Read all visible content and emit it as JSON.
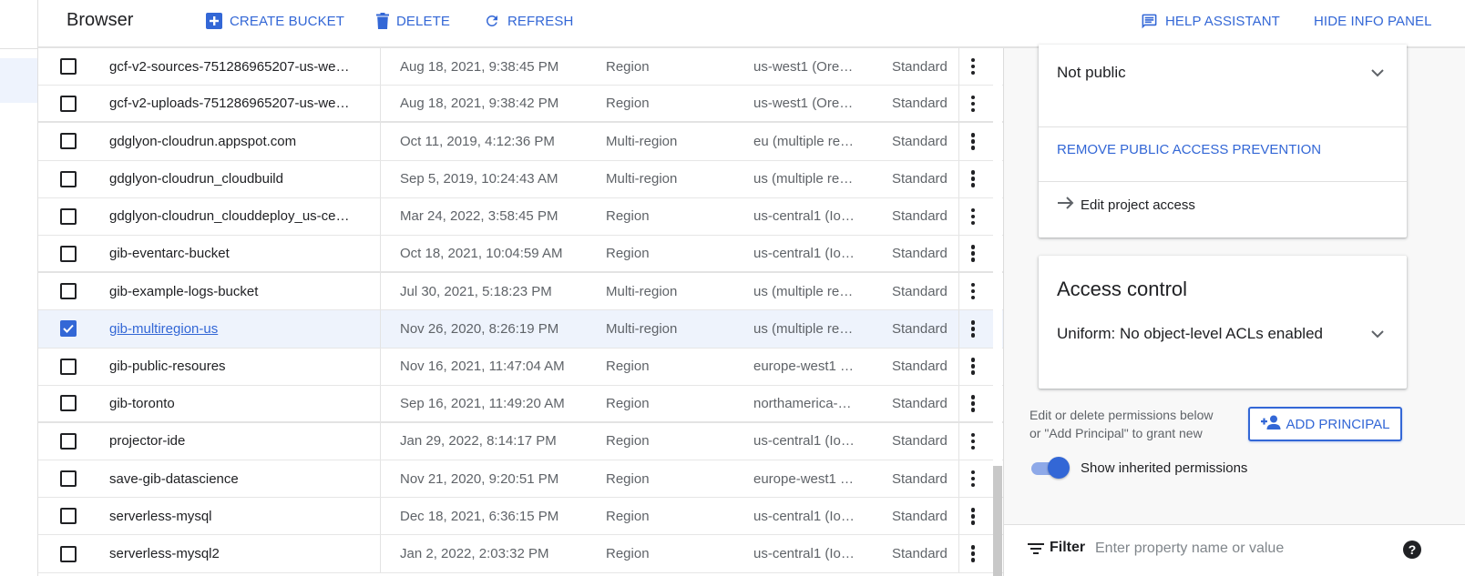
{
  "header": {
    "title": "Browser",
    "create_bucket_label": "CREATE BUCKET",
    "delete_label": "DELETE",
    "refresh_label": "REFRESH",
    "help_assistant_label": "HELP ASSISTANT",
    "hide_info_panel_label": "HIDE INFO PANEL",
    "accent_color": "#3367d6"
  },
  "buckets": [
    {
      "name": "gcf-v2-sources-751286965207-us-we…",
      "created": "Aug 18, 2021, 9:38:45 PM",
      "location_type": "Region",
      "location": "us-west1 (Ore…",
      "storage_class": "Standard",
      "checked": false
    },
    {
      "name": "gcf-v2-uploads-751286965207-us-we…",
      "created": "Aug 18, 2021, 9:38:42 PM",
      "location_type": "Region",
      "location": "us-west1 (Ore…",
      "storage_class": "Standard",
      "checked": false
    },
    {
      "name": "gdglyon-cloudrun.appspot.com",
      "created": "Oct 11, 2019, 4:12:36 PM",
      "location_type": "Multi-region",
      "location": "eu (multiple re…",
      "storage_class": "Standard",
      "checked": false
    },
    {
      "name": "gdglyon-cloudrun_cloudbuild",
      "created": "Sep 5, 2019, 10:24:43 AM",
      "location_type": "Multi-region",
      "location": "us (multiple re…",
      "storage_class": "Standard",
      "checked": false
    },
    {
      "name": "gdglyon-cloudrun_clouddeploy_us-ce…",
      "created": "Mar 24, 2022, 3:58:45 PM",
      "location_type": "Region",
      "location": "us-central1 (Io…",
      "storage_class": "Standard",
      "checked": false
    },
    {
      "name": "gib-eventarc-bucket",
      "created": "Oct 18, 2021, 10:04:59 AM",
      "location_type": "Region",
      "location": "us-central1 (Io…",
      "storage_class": "Standard",
      "checked": false
    },
    {
      "name": "gib-example-logs-bucket",
      "created": "Jul 30, 2021, 5:18:23 PM",
      "location_type": "Multi-region",
      "location": "us (multiple re…",
      "storage_class": "Standard",
      "checked": false
    },
    {
      "name": "gib-multiregion-us",
      "created": "Nov 26, 2020, 8:26:19 PM",
      "location_type": "Multi-region",
      "location": "us (multiple re…",
      "storage_class": "Standard",
      "checked": true
    },
    {
      "name": "gib-public-resoures",
      "created": "Nov 16, 2021, 11:47:04 AM",
      "location_type": "Region",
      "location": "europe-west1 …",
      "storage_class": "Standard",
      "checked": false
    },
    {
      "name": "gib-toronto",
      "created": "Sep 16, 2021, 11:49:20 AM",
      "location_type": "Region",
      "location": "northamerica-…",
      "storage_class": "Standard",
      "checked": false
    },
    {
      "name": "projector-ide",
      "created": "Jan 29, 2022, 8:14:17 PM",
      "location_type": "Region",
      "location": "us-central1 (Io…",
      "storage_class": "Standard",
      "checked": false
    },
    {
      "name": "save-gib-datascience",
      "created": "Nov 21, 2020, 9:20:51 PM",
      "location_type": "Region",
      "location": "europe-west1 …",
      "storage_class": "Standard",
      "checked": false
    },
    {
      "name": "serverless-mysql",
      "created": "Dec 18, 2021, 6:36:15 PM",
      "location_type": "Region",
      "location": "us-central1 (Io…",
      "storage_class": "Standard",
      "checked": false
    },
    {
      "name": "serverless-mysql2",
      "created": "Jan 2, 2022, 2:03:32 PM",
      "location_type": "Region",
      "location": "us-central1 (Io…",
      "storage_class": "Standard",
      "checked": false
    }
  ],
  "info_panel": {
    "public_access": {
      "status": "Not public",
      "remove_prevention_label": "REMOVE PUBLIC ACCESS PREVENTION",
      "edit_project_access_label": "Edit project access"
    },
    "access_control": {
      "title": "Access control",
      "value": "Uniform: No object-level ACLs enabled"
    },
    "permissions": {
      "help_text_line1": "Edit or delete permissions below",
      "help_text_line2": "or \"Add Principal\" to grant new",
      "add_principal_label": "ADD PRINCIPAL",
      "show_inherited_label": "Show inherited permissions",
      "show_inherited_on": true
    },
    "filter": {
      "label": "Filter",
      "placeholder": "Enter property name or value",
      "value": "",
      "help_glyph": "?"
    }
  }
}
